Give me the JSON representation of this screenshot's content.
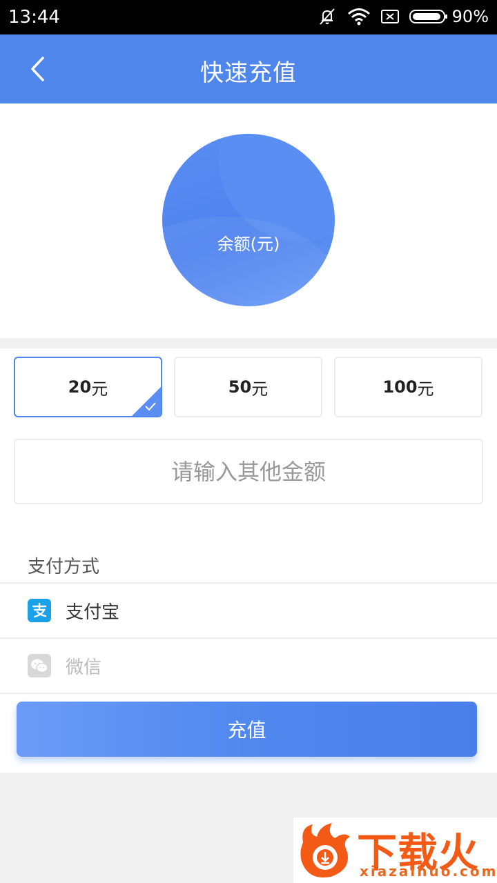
{
  "status_bar": {
    "time": "13:44",
    "battery": "90%"
  },
  "nav": {
    "title": "快速充值"
  },
  "balance": {
    "label": "余额(元)"
  },
  "amounts": [
    {
      "num": "20",
      "unit": "元",
      "selected": true
    },
    {
      "num": "50",
      "unit": "元",
      "selected": false
    },
    {
      "num": "100",
      "unit": "元",
      "selected": false
    }
  ],
  "other_amount": {
    "placeholder": "请输入其他金额"
  },
  "payment": {
    "title": "支付方式",
    "methods": [
      {
        "label": "支付宝",
        "icon": "alipay-icon",
        "color": "#1aa1e8",
        "enabled": true
      },
      {
        "label": "微信",
        "icon": "wechat-icon",
        "color": "#d8d8d8",
        "enabled": false
      }
    ]
  },
  "submit": {
    "label": "充值"
  },
  "watermark": {
    "text": "下载火",
    "sub": "xiazaihuo.com"
  },
  "colors": {
    "primary": "#4f86ec",
    "accent_orange": "#f25a16"
  }
}
